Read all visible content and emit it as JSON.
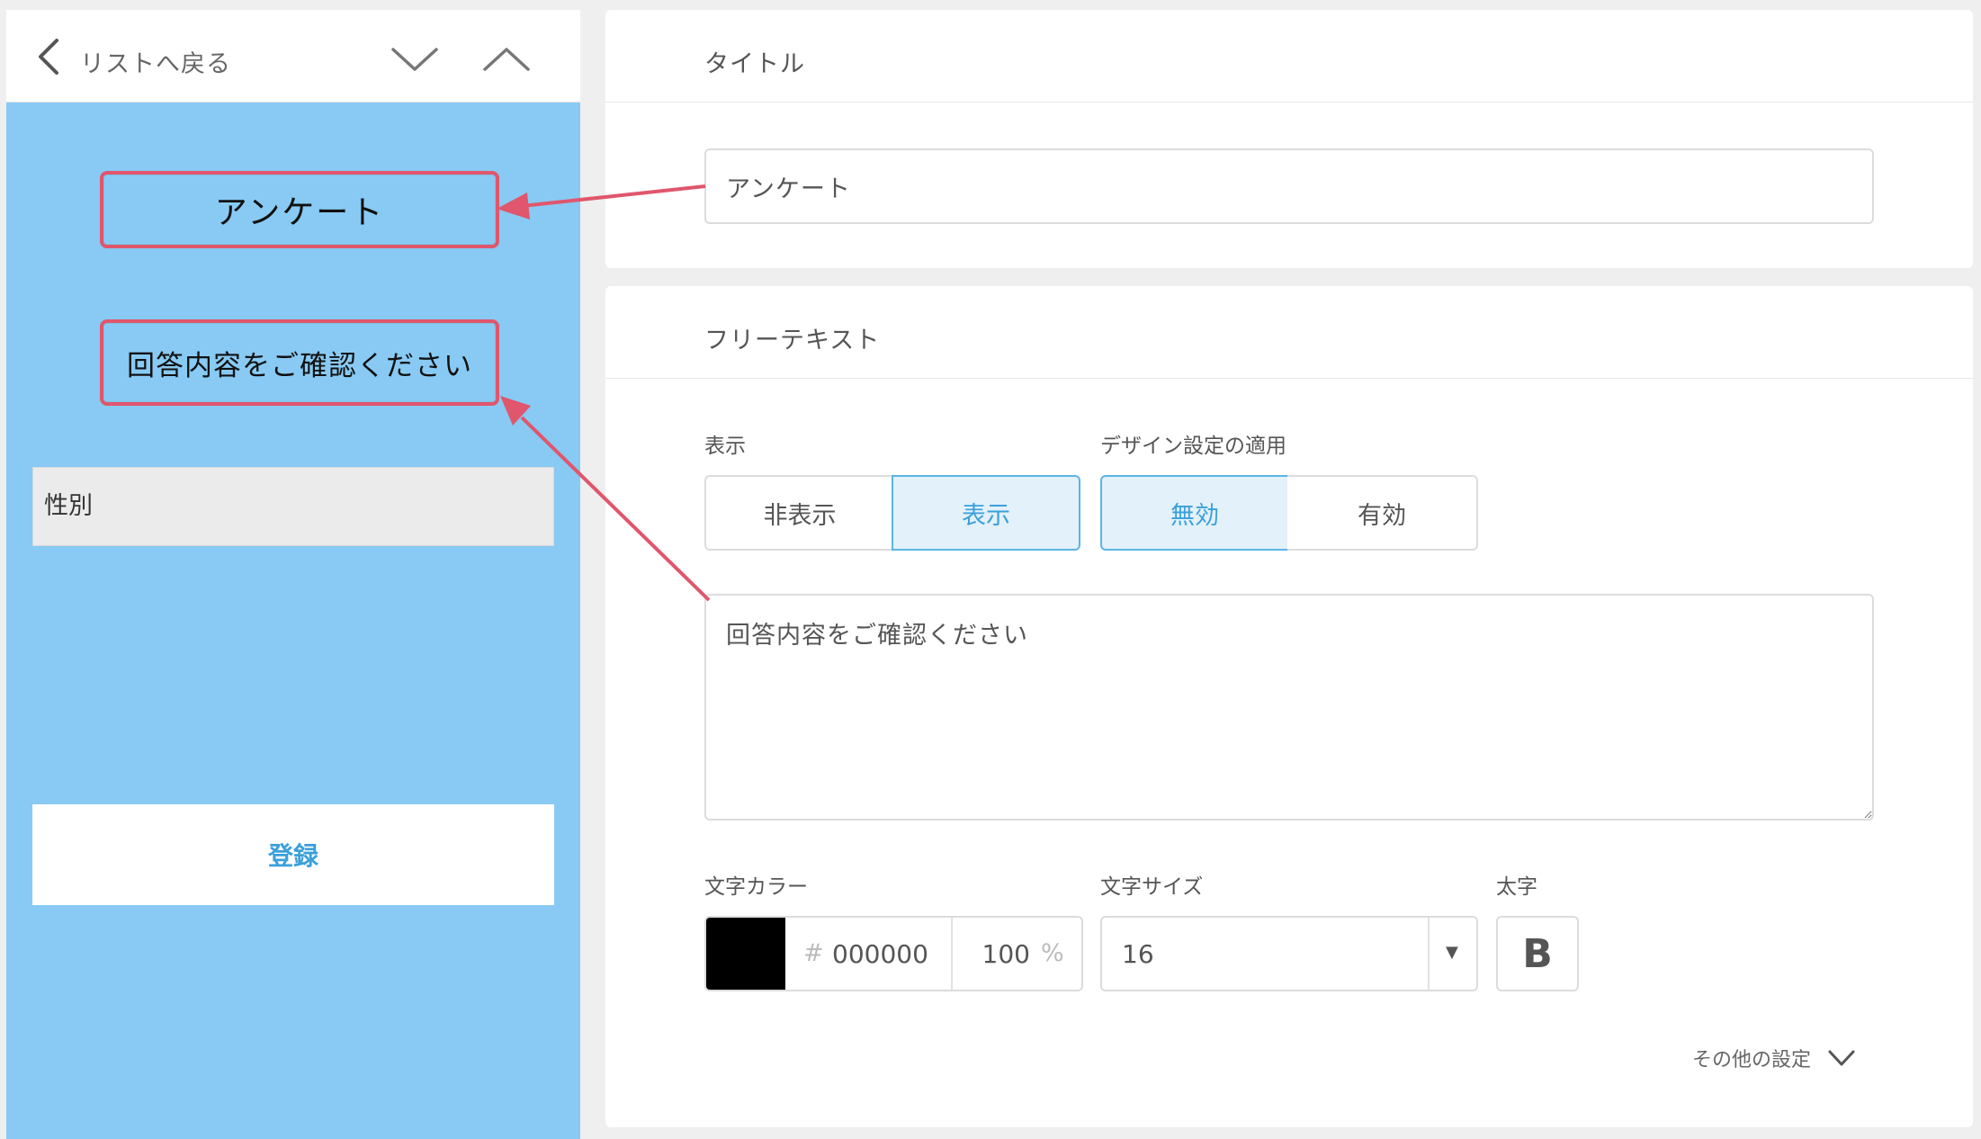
{
  "nav": {
    "back_label": "リストへ戻る"
  },
  "preview": {
    "title": "アンケート",
    "free_text": "回答内容をご確認ください",
    "field_label": "性別",
    "register_label": "登録",
    "background_color": "#88caf3",
    "highlight_color": "#e0566c"
  },
  "title_panel": {
    "header": "タイトル",
    "input_value": "アンケート"
  },
  "free_text_panel": {
    "header": "フリーテキスト",
    "display": {
      "label": "表示",
      "options": [
        "非表示",
        "表示"
      ],
      "selected": "表示"
    },
    "design": {
      "label": "デザイン設定の適用",
      "options": [
        "無効",
        "有効"
      ],
      "selected": "無効"
    },
    "textarea_value": "回答内容をご確認ください",
    "text_color": {
      "label": "文字カラー",
      "hash": "#",
      "hex": "000000",
      "opacity": "100",
      "percent": "%",
      "swatch": "#000000"
    },
    "text_size": {
      "label": "文字サイズ",
      "value": "16"
    },
    "bold": {
      "label": "太字",
      "button": "B"
    },
    "more_settings": "その他の設定"
  },
  "accent_color": "#3aa0da"
}
